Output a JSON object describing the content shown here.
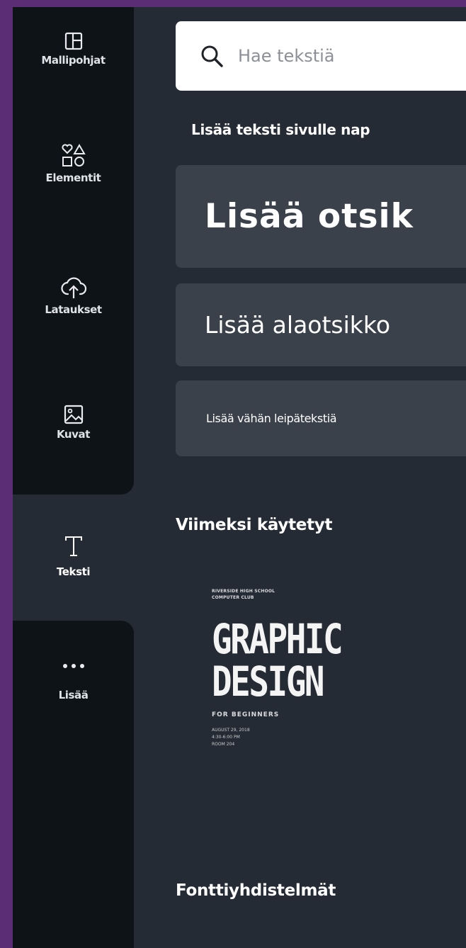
{
  "sidebar": {
    "items": [
      {
        "label": "Mallipohjat",
        "icon": "templates-icon"
      },
      {
        "label": "Elementit",
        "icon": "elements-icon"
      },
      {
        "label": "Lataukset",
        "icon": "upload-cloud-icon"
      },
      {
        "label": "Kuvat",
        "icon": "photos-icon"
      },
      {
        "label": "Teksti",
        "icon": "text-icon",
        "active": true
      },
      {
        "label": "Lisää",
        "icon": "more-dots-icon"
      }
    ]
  },
  "panel": {
    "search": {
      "placeholder": "Hae tekstiä"
    },
    "instruction": "Lisää teksti sivulle nap",
    "buttons": {
      "heading": "Lisää otsik",
      "subheading": "Lisää alaotsikko",
      "body": "Lisää vähän leipätekstiä"
    },
    "recent_title": "Viimeksi käytetyt",
    "recent_card": {
      "line1": "RIVERSIDE HIGH SCHOOL",
      "line2": "COMPUTER CLUB",
      "title1": "GRAPHIC",
      "title2": "DESIGN",
      "subtitle": "FOR BEGINNERS",
      "date": "AUGUST 29, 2018",
      "time": "4:30-6:00 PM",
      "room": "ROOM 204"
    },
    "combos_title": "Fonttiyhdistelmät"
  },
  "colors": {
    "background_purple": "#5b2d75",
    "sidebar": "#0e1318",
    "panel": "#252b34",
    "button": "#3a414b"
  }
}
